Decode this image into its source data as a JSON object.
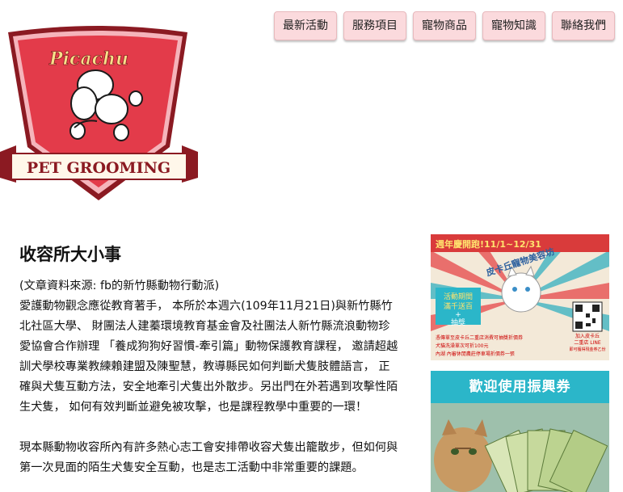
{
  "nav": {
    "items": [
      {
        "label": "最新活動"
      },
      {
        "label": "服務項目"
      },
      {
        "label": "寵物商品"
      },
      {
        "label": "寵物知識"
      },
      {
        "label": "聯絡我們"
      }
    ]
  },
  "logo": {
    "script_text": "Picachu",
    "banner_text": "PET GROOMING"
  },
  "article": {
    "title": "收容所大小事",
    "source": "(文章資料來源: fb的新竹縣動物行動派)",
    "body1": "愛護動物觀念應從教育著手， 本所於本週六(109年11月21日)與新竹縣竹北社區大學、 財團法人建蓁環境教育基金會及社團法人新竹縣流浪動物珍愛協會合作辦理 「養成狗狗好習慣-牽引篇」動物保護教育課程， 邀請超越訓犬學校專業教練賴建盟及陳聖慧，教導縣民如何判斷犬隻肢體語言， 正確與犬隻互動方法，安全地牽引犬隻出外散步。另出門在外若遇到攻擊性陌生犬隻， 如何有效判斷並避免被攻擊，也是課程教學中重要的一環！",
    "body2": "現本縣動物收容所內有許多熱心志工會安排帶收容犬隻出籠散步，但如何與第一次見面的陌生犬隻安全互動，也是志工活動中非常重要的課題。"
  },
  "sidebar": {
    "ad1": {
      "headline": "週年慶開跑!11/1~12/31",
      "brand": "皮卡丘寵物美容坊",
      "promo1": "活動期間",
      "promo2": "滿千送百",
      "promo3": "+",
      "promo4": "抽獎",
      "qr_caption": "加入皮卡丘",
      "qr_caption2": "二重店 LINE",
      "qr_caption3": "即可獲得現金券乙份",
      "line1": "憑傳單至皮卡丘二重店消費可抽獎折價券",
      "line2": "犬貓洗澡單次可折100元",
      "line3": "內湖 內審休閒農莊停車場折價券一張"
    },
    "ad2": {
      "headline": "歡迎使用振興券"
    }
  },
  "colors": {
    "nav_bg": "#fbdadd",
    "logo_red": "#e33b4a",
    "logo_dark": "#8b1a22",
    "ad_teal": "#2bb6c9"
  }
}
